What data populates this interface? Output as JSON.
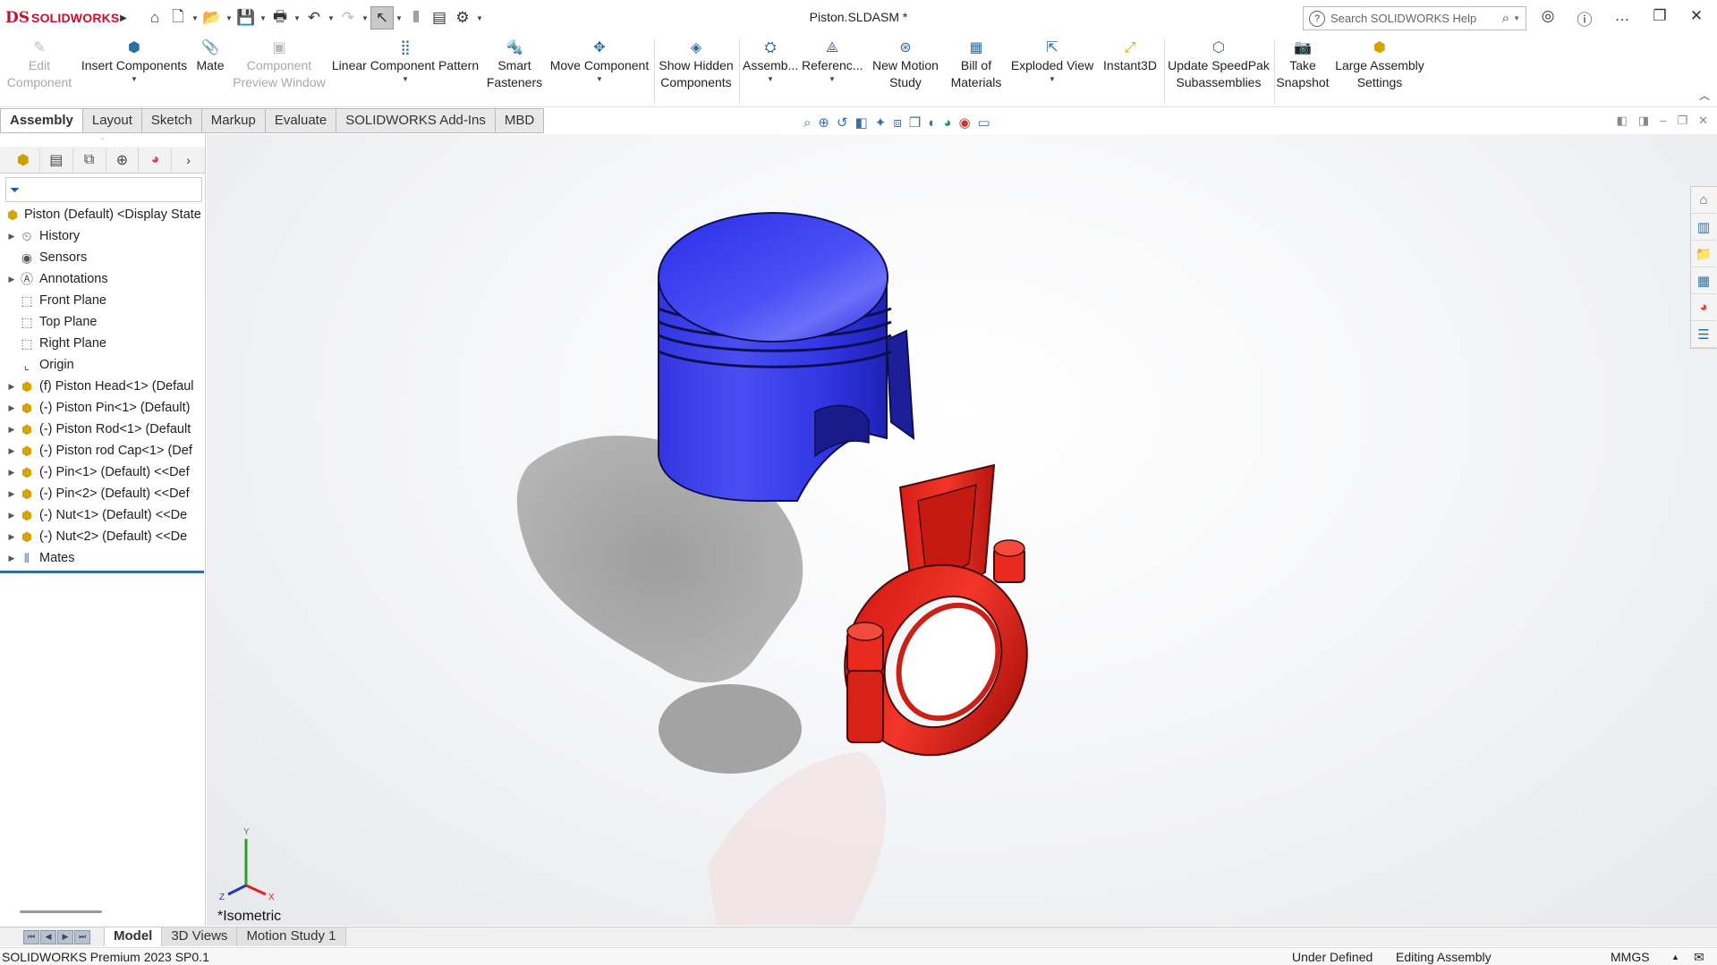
{
  "app": {
    "logo_mark": "DS",
    "logo_text": "SOLIDWORKS",
    "document_title": "Piston.SLDASM *"
  },
  "search": {
    "placeholder": "Search SOLIDWORKS Help"
  },
  "command_manager": {
    "buttons": [
      {
        "line1": "Edit",
        "line2": "Component",
        "enabled": false
      },
      {
        "line1": "Insert Components",
        "line2": "",
        "enabled": true
      },
      {
        "line1": "Mate",
        "line2": "",
        "enabled": true
      },
      {
        "line1": "Component",
        "line2": "Preview Window",
        "enabled": false
      },
      {
        "line1": "Linear Component Pattern",
        "line2": "",
        "enabled": true
      },
      {
        "line1": "Smart",
        "line2": "Fasteners",
        "enabled": true
      },
      {
        "line1": "Move Component",
        "line2": "",
        "enabled": true
      },
      {
        "line1": "Show Hidden",
        "line2": "Components",
        "enabled": true
      },
      {
        "line1": "Assemb...",
        "line2": "",
        "enabled": true
      },
      {
        "line1": "Referenc...",
        "line2": "",
        "enabled": true
      },
      {
        "line1": "New Motion",
        "line2": "Study",
        "enabled": true
      },
      {
        "line1": "Bill of",
        "line2": "Materials",
        "enabled": true
      },
      {
        "line1": "Exploded View",
        "line2": "",
        "enabled": true
      },
      {
        "line1": "Instant3D",
        "line2": "",
        "enabled": true
      },
      {
        "line1": "Update SpeedPak",
        "line2": "Subassemblies",
        "enabled": true
      },
      {
        "line1": "Take",
        "line2": "Snapshot",
        "enabled": true
      },
      {
        "line1": "Large Assembly",
        "line2": "Settings",
        "enabled": true
      }
    ]
  },
  "tabs": [
    "Assembly",
    "Layout",
    "Sketch",
    "Markup",
    "Evaluate",
    "SOLIDWORKS Add-Ins",
    "MBD"
  ],
  "active_tab": "Assembly",
  "feature_tree": {
    "root": "Piston (Default) <Display State",
    "items": [
      {
        "label": "History",
        "expandable": true,
        "icon": "history-icon"
      },
      {
        "label": "Sensors",
        "expandable": false,
        "icon": "sensors-icon"
      },
      {
        "label": "Annotations",
        "expandable": true,
        "icon": "annotations-icon"
      },
      {
        "label": "Front Plane",
        "expandable": false,
        "icon": "plane-icon"
      },
      {
        "label": "Top Plane",
        "expandable": false,
        "icon": "plane-icon"
      },
      {
        "label": "Right Plane",
        "expandable": false,
        "icon": "plane-icon"
      },
      {
        "label": "Origin",
        "expandable": false,
        "icon": "origin-icon"
      },
      {
        "label": "(f) Piston Head<1> (Defaul",
        "expandable": true,
        "icon": "part-icon"
      },
      {
        "label": "(-) Piston Pin<1> (Default)",
        "expandable": true,
        "icon": "part-icon"
      },
      {
        "label": "(-) Piston Rod<1> (Default",
        "expandable": true,
        "icon": "part-icon"
      },
      {
        "label": "(-) Piston rod Cap<1> (Def",
        "expandable": true,
        "icon": "part-icon"
      },
      {
        "label": "(-) Pin<1> (Default) <<Def",
        "expandable": true,
        "icon": "part-icon"
      },
      {
        "label": "(-) Pin<2> (Default) <<Def",
        "expandable": true,
        "icon": "part-icon"
      },
      {
        "label": "(-) Nut<1> (Default) <<De",
        "expandable": true,
        "icon": "part-icon"
      },
      {
        "label": "(-) Nut<2> (Default) <<De",
        "expandable": true,
        "icon": "part-icon"
      },
      {
        "label": "Mates",
        "expandable": true,
        "icon": "mates-icon"
      }
    ]
  },
  "viewport": {
    "view_label": "*Isometric",
    "triad": {
      "x": "X",
      "y": "Y",
      "z": "Z"
    },
    "colors": {
      "piston": "#3b3ff0",
      "rod": "#e8281e",
      "shadow": "#9a9a9a"
    }
  },
  "bottom_tabs": [
    "Model",
    "3D Views",
    "Motion Study 1"
  ],
  "active_bottom_tab": "Model",
  "status": {
    "product": "SOLIDWORKS Premium 2023 SP0.1",
    "state": "Under Defined",
    "mode": "Editing Assembly",
    "units": "MMGS"
  }
}
